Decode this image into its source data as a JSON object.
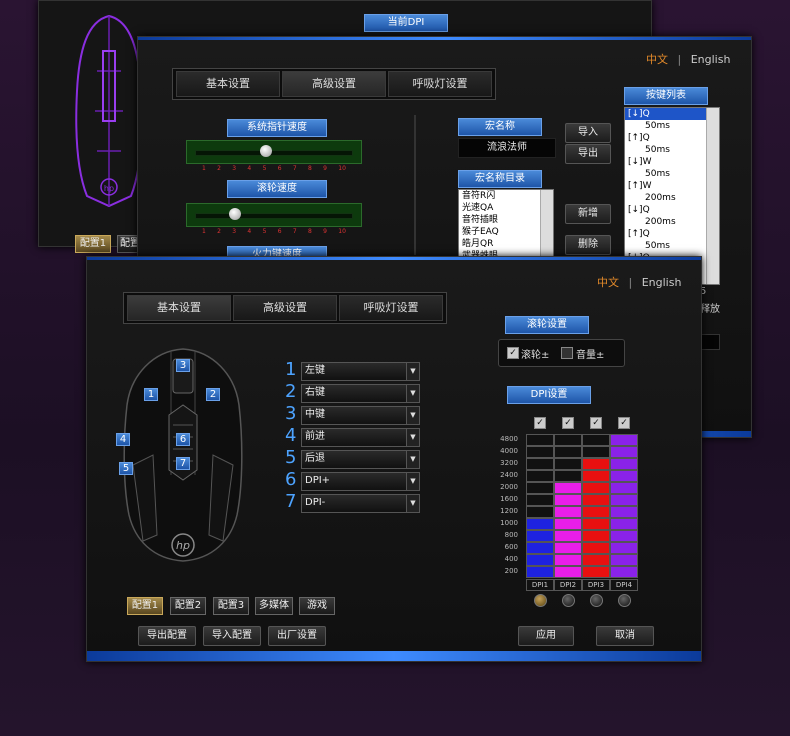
{
  "back_window": {
    "top_label": "当前DPI",
    "lang_zh": "中文",
    "lang_sep": "|",
    "lang_en": "English",
    "tabs": [
      "基本设置",
      "高级设置",
      "呼吸灯设置"
    ],
    "sliders": [
      {
        "label": "系统指针速度",
        "value": 5
      },
      {
        "label": "滚轮速度",
        "value": 3
      },
      {
        "label": "火力键速度"
      }
    ],
    "ticks": [
      "1",
      "2",
      "3",
      "4",
      "5",
      "6",
      "7",
      "8",
      "9",
      "10"
    ],
    "macro_name_label": "宏名称",
    "macro_name_value": "流浪法师",
    "macro_list_label": "宏名称目录",
    "macro_list": [
      "音符R闪",
      "光速QA",
      "音符插眼",
      "猴子EAQ",
      "皓月QR",
      "武器蛛眼"
    ],
    "import_btn": "导入",
    "export_btn": "导出",
    "new_btn": "新增",
    "delete_btn": "删除",
    "key_list_label": "按键列表",
    "key_list": [
      "[↓]Q",
      "50ms",
      "[↑]Q",
      "50ms",
      "[↓]W",
      "50ms",
      "[↑]W",
      "200ms",
      "[↓]Q",
      "200ms",
      "[↑]Q",
      "50ms",
      "[↓]Q"
    ],
    "partial_text_1": "5",
    "partial_text_2": "释放",
    "config_tabs": [
      "配置1",
      "配置"
    ]
  },
  "front_window": {
    "lang_zh": "中文",
    "lang_sep": "|",
    "lang_en": "English",
    "tabs": [
      "基本设置",
      "高级设置",
      "呼吸灯设置"
    ],
    "mouse_labels": [
      "1",
      "2",
      "3",
      "4",
      "5",
      "6",
      "7"
    ],
    "hp_logo": "hp",
    "key_rows": [
      {
        "num": "1",
        "value": "左键"
      },
      {
        "num": "2",
        "value": "右键"
      },
      {
        "num": "3",
        "value": "中键"
      },
      {
        "num": "4",
        "value": "前进"
      },
      {
        "num": "5",
        "value": "后退"
      },
      {
        "num": "6",
        "value": "DPI+"
      },
      {
        "num": "7",
        "value": "DPI-"
      }
    ],
    "wheel_title": "滚轮设置",
    "wheel_opt1": "滚轮±",
    "wheel_opt2": "音量±",
    "dpi_title": "DPI设置",
    "dpi_y_labels": [
      "4800",
      "4000",
      "3200",
      "2400",
      "2000",
      "1600",
      "1200",
      "1000",
      "800",
      "600",
      "400",
      "200"
    ],
    "dpi_x_labels": [
      "DPI1",
      "DPI2",
      "DPI3",
      "DPI4"
    ],
    "dpi_colors": [
      "#1e22e0",
      "#e81ee8",
      "#e81010",
      "#8a22e8"
    ],
    "dpi_selected_index": 0,
    "config_buttons": [
      "配置1",
      "配置2",
      "配置3",
      "多媒体",
      "游戏"
    ],
    "export_config": "导出配置",
    "import_config": "导入配置",
    "factory_reset": "出厂设置",
    "apply": "应用",
    "cancel": "取消"
  },
  "chart_data": {
    "type": "bar",
    "categories": [
      "DPI1",
      "DPI2",
      "DPI3",
      "DPI4"
    ],
    "y_ticks": [
      "200",
      "400",
      "600",
      "800",
      "1000",
      "1200",
      "1600",
      "2000",
      "2400",
      "3200",
      "4000",
      "4800"
    ],
    "values": [
      1000,
      2000,
      3200,
      4800
    ],
    "enabled": [
      true,
      true,
      true,
      true
    ]
  }
}
